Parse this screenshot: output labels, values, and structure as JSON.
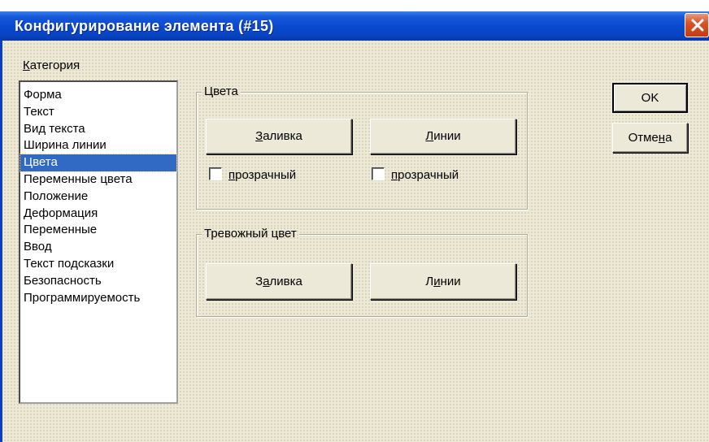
{
  "dialog": {
    "title": "Конфигурирование элемента (#15)"
  },
  "category": {
    "label_underline": "К",
    "label_rest": "атегория",
    "items": [
      {
        "label": "Форма"
      },
      {
        "label": "Текст"
      },
      {
        "label": "Вид текста"
      },
      {
        "label": "Ширина линии"
      },
      {
        "label": "Цвета",
        "selected": true
      },
      {
        "label": "Переменные цвета"
      },
      {
        "label": "Положение"
      },
      {
        "label": "Деформация"
      },
      {
        "label": "Переменные"
      },
      {
        "label": "Ввод"
      },
      {
        "label": "Текст подсказки"
      },
      {
        "label": "Безопасность"
      },
      {
        "label": "Программируемость"
      }
    ]
  },
  "colors_group": {
    "title": "Цвета",
    "fill_button": {
      "underline": "З",
      "rest": "аливка"
    },
    "lines_button": {
      "underline": "Л",
      "rest": "инии"
    },
    "fill_transparent": {
      "underline": "п",
      "rest": "розрачный",
      "checked": false
    },
    "lines_transparent": {
      "underline": "п",
      "rest": "розрачный",
      "checked": false
    }
  },
  "alarm_group": {
    "title": "Тревожный цвет",
    "fill_button": {
      "pre": "З",
      "underline": "а",
      "rest": "ливка"
    },
    "lines_button": {
      "pre": "Л",
      "underline": "и",
      "rest": "нии"
    }
  },
  "actions": {
    "ok_label": "OK",
    "cancel_pre": "Отме",
    "cancel_underline": "н",
    "cancel_rest": "а"
  },
  "colors": {
    "titlebar": "#0a4ad0",
    "selection": "#316ac5",
    "close": "#d9542a"
  }
}
